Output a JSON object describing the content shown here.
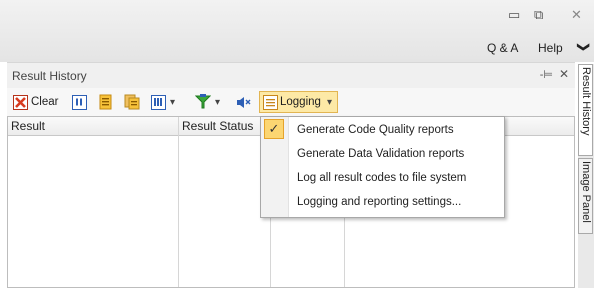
{
  "window": {
    "minimize_glyph": "▭",
    "restore_glyph": "⧉",
    "close_glyph": "✕"
  },
  "menu": {
    "qa": "Q & A",
    "help": "Help",
    "chevron_glyph": "❯"
  },
  "panel": {
    "title": "Result History",
    "pin_glyph": "-⊨",
    "close_glyph": "✕"
  },
  "toolbar": {
    "clear_label": "Clear",
    "logging_label": "Logging",
    "dropdown_arrow": "▾",
    "icons": [
      "clear-icon",
      "pause-icon",
      "copy-report-icon",
      "export-report-icon",
      "columns-icon",
      "filter-icon",
      "mute-sound-icon",
      "logging-icon"
    ]
  },
  "grid": {
    "columns": [
      "Result",
      "Result Status"
    ]
  },
  "logging_menu": {
    "items": [
      {
        "label": "Generate Code Quality reports",
        "checked": true
      },
      {
        "label": "Generate Data Validation reports",
        "checked": false
      },
      {
        "label": "Log all result codes to file system",
        "checked": false
      },
      {
        "label": "Logging and reporting settings...",
        "checked": false
      }
    ],
    "check_glyph": "✓"
  },
  "side_tabs": [
    "Result History",
    "Image Panel"
  ],
  "colors": {
    "accent_orange": "#fcd672",
    "clear_red": "#d83b1f",
    "blue_icon": "#2d5fb5"
  }
}
